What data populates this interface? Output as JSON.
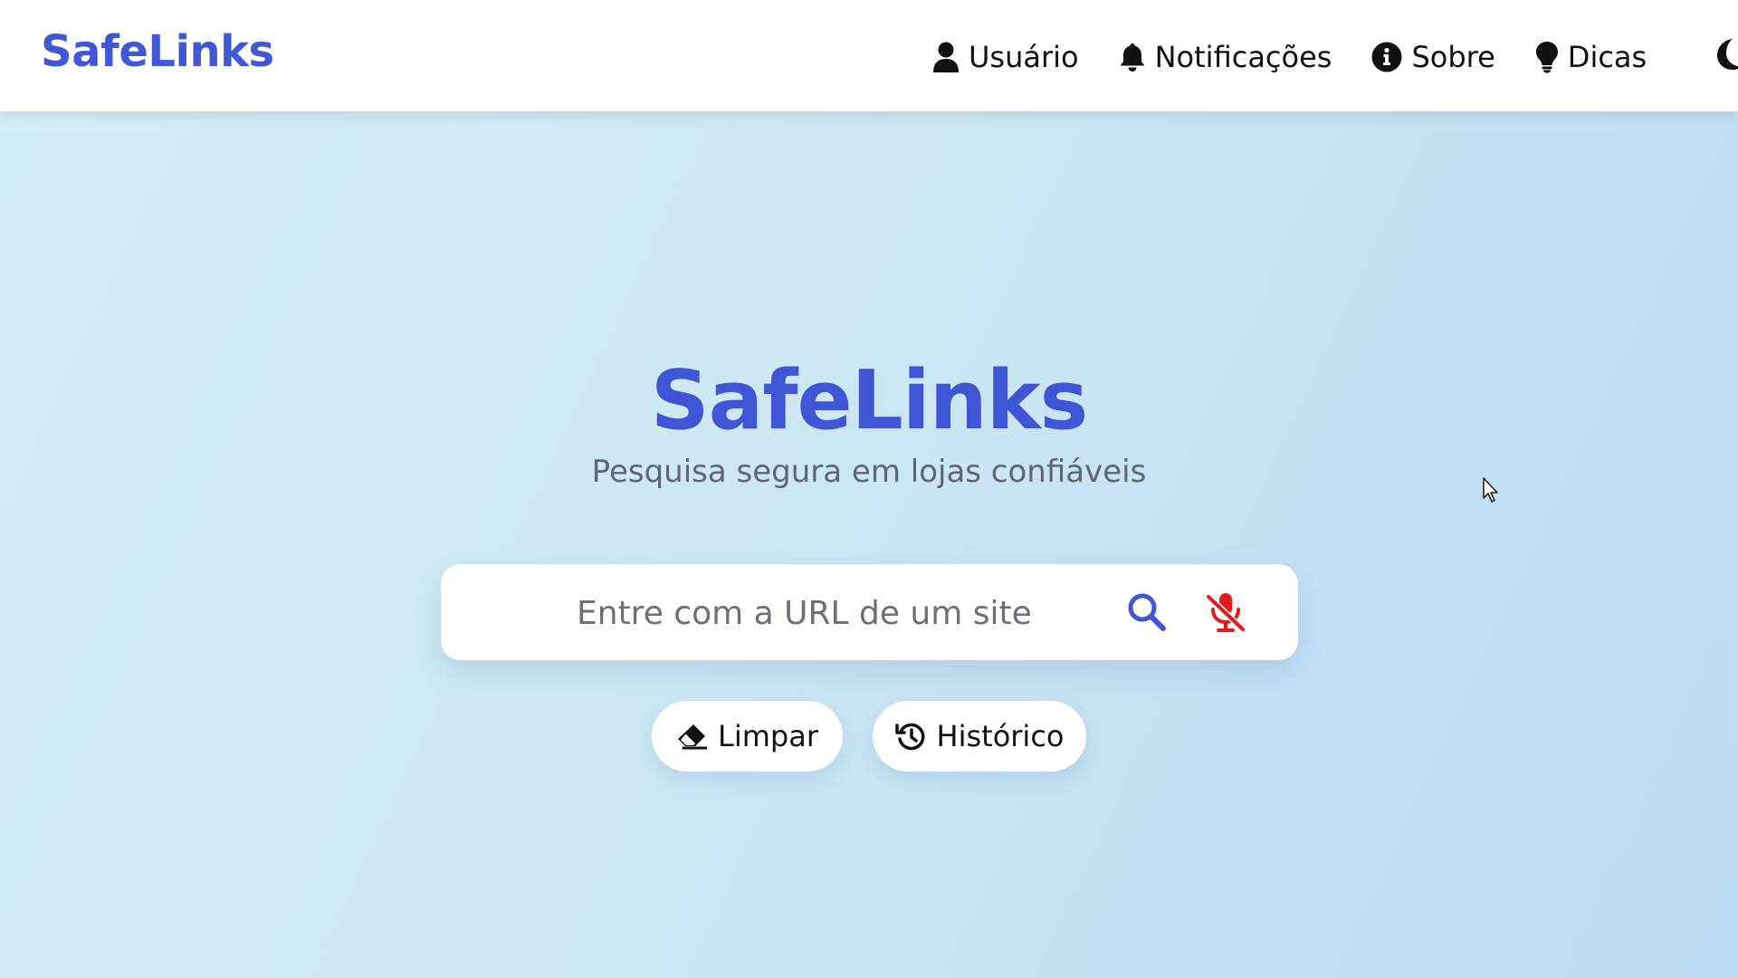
{
  "header": {
    "brand": "SafeLinks",
    "nav": [
      {
        "icon": "user-icon",
        "label": "Usuário"
      },
      {
        "icon": "bell-icon",
        "label": "Notificações"
      },
      {
        "icon": "info-circle-icon",
        "label": "Sobre"
      },
      {
        "icon": "lightbulb-icon",
        "label": "Dicas"
      }
    ],
    "theme_toggle_icon": "moon-icon"
  },
  "hero": {
    "title": "SafeLinks",
    "subtitle": "Pesquisa segura em lojas confiáveis"
  },
  "search": {
    "placeholder": "Entre com a URL de um site",
    "value": "",
    "search_icon": "search-icon",
    "mic_icon": "mic-muted-icon"
  },
  "actions": {
    "clear_label": "Limpar",
    "clear_icon": "eraser-icon",
    "history_label": "Histórico",
    "history_icon": "history-icon"
  },
  "colors": {
    "brand": "#4158d6",
    "search_icon": "#3f55d6",
    "mic_icon": "#e01d1d",
    "background_start": "#d3eef6",
    "background_end": "#bcdbf4"
  }
}
